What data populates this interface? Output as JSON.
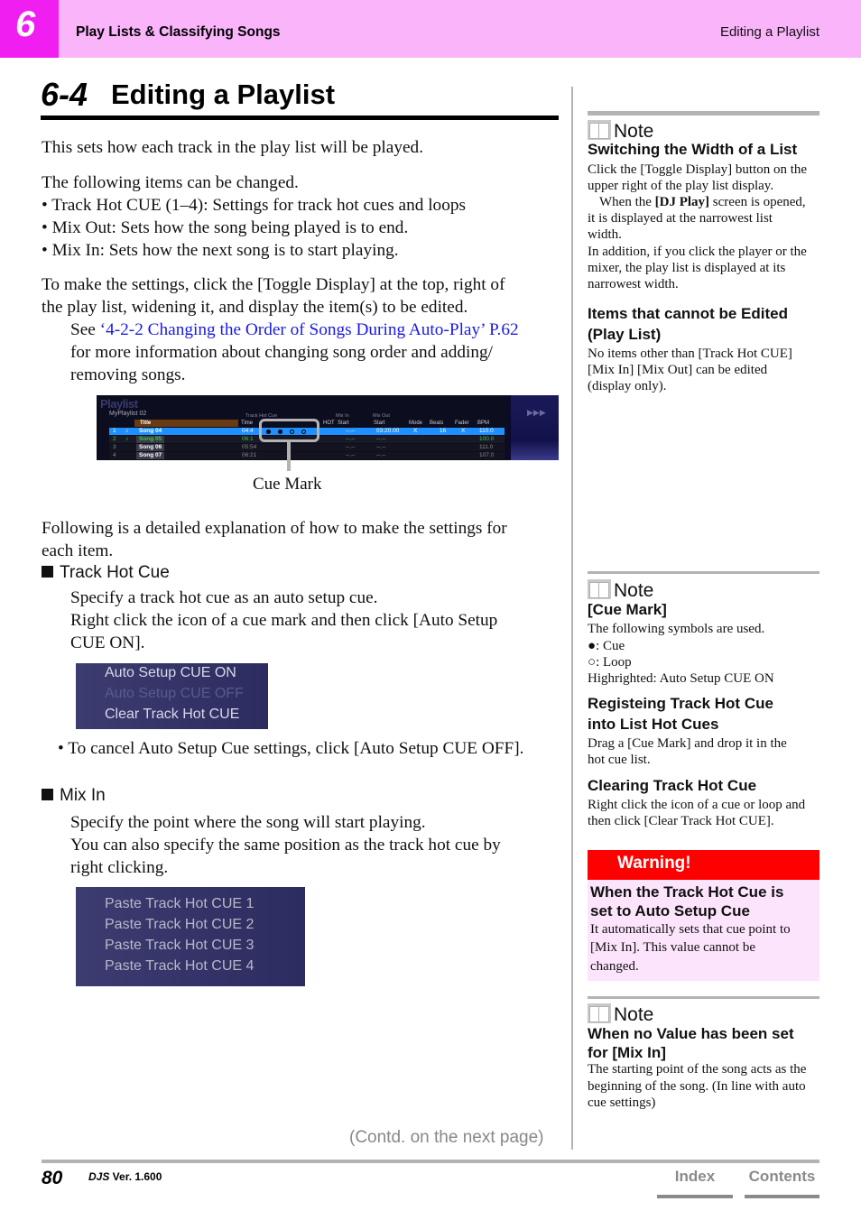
{
  "header": {
    "chapter_number": "6",
    "chapter_title": "Play Lists & Classifying Songs",
    "section_right": "Editing a Playlist"
  },
  "page_title": {
    "number": "6-4",
    "text": "Editing a Playlist"
  },
  "main": {
    "intro": "This sets how each track in the play list will be played.",
    "items_intro": "The following items can be changed.",
    "items": [
      "• Track Hot CUE (1–4): Settings for track hot cues and loops",
      "• Mix Out: Sets how the song being played is to end.",
      "• Mix In: Sets how the next song is to start playing."
    ],
    "settings_line1": "To make the settings, click the [Toggle Display] at the top, right of",
    "settings_line2": "the play list, widening it, and display the item(s) to be edited.",
    "see_prefix": "See ",
    "see_link": "‘4-2-2 Changing the Order of Songs During Auto-Play’ P.62",
    "see_line2": "for more information about changing song order and adding/",
    "see_line3": "removing songs.",
    "cue_mark_label": "Cue Mark",
    "detail_line1": "Following is a detailed explanation of how to make the settings for",
    "detail_line2": "each item.",
    "track_hot_cue": {
      "heading": "Track Hot Cue",
      "line1": "Specify a track hot cue as an auto setup cue.",
      "line2": "Right click the icon of a cue mark and then click [Auto Setup",
      "line3": "CUE ON].",
      "menu": [
        {
          "label": "Auto Setup CUE ON",
          "enabled": true
        },
        {
          "label": "Auto Setup CUE OFF",
          "enabled": false
        },
        {
          "label": "Clear Track Hot CUE",
          "enabled": true
        }
      ],
      "cancel_note": "•  To cancel Auto Setup Cue settings, click [Auto Setup CUE OFF]."
    },
    "mix_in": {
      "heading": "Mix In",
      "line1": "Specify the point where the song will start playing.",
      "line2": "You can also specify the same position as the track hot cue by",
      "line3": "right clicking.",
      "menu": [
        {
          "label": "Paste Track Hot CUE 1"
        },
        {
          "label": "Paste Track Hot CUE 2"
        },
        {
          "label": "Paste Track Hot CUE 3"
        },
        {
          "label": "Paste Track Hot CUE 4"
        }
      ]
    }
  },
  "playlist_screenshot": {
    "logo": "Playlist",
    "playlist_name": "MyPlaylist 02",
    "group_headers": {
      "track_hot_cue": "Track  Hot  Cue",
      "mix_in": "Mix  In",
      "mix_out": "Mix  Out"
    },
    "columns": [
      "Title",
      "Time",
      "1",
      "2",
      "3",
      "4",
      "HOT",
      "Start",
      "Start",
      "Mode",
      "Beats",
      "Fader",
      "BPM"
    ],
    "rows": [
      {
        "num": "1",
        "title": "Song 04",
        "time": "04:4",
        "cues": [
          "cue",
          "cue",
          "loop",
          "loop"
        ],
        "mix_in_start": "--.--",
        "mix_out_start": "03:20.00",
        "mode": "X",
        "beats": "16",
        "fader": "X",
        "bpm": "110.0",
        "state": "selected"
      },
      {
        "num": "2",
        "title": "Song 05",
        "time": "06:1",
        "cues": [],
        "mix_in_start": "--.--",
        "mix_out_start": "--.--",
        "mode": "",
        "beats": "",
        "fader": "",
        "bpm": "100.0",
        "state": "playing"
      },
      {
        "num": "3",
        "title": "Song 06",
        "time": "05:54",
        "cues": [],
        "mix_in_start": "--.--",
        "mix_out_start": "--.--",
        "mode": "",
        "beats": "",
        "fader": "",
        "bpm": "111.0",
        "state": "normal"
      },
      {
        "num": "4",
        "title": "Song 07",
        "time": "06:21",
        "cues": [],
        "mix_in_start": "--.--",
        "mix_out_start": "--.--",
        "mode": "",
        "beats": "",
        "fader": "",
        "bpm": "107.0",
        "state": "normal"
      }
    ]
  },
  "sidebar": {
    "note_label": "Note",
    "note1": {
      "heading": "Switching the Width of a List",
      "body_line1": "Click the [Toggle Display] button on the",
      "body_line2": "upper right of the play list display.",
      "body_line3_pre": "When the ",
      "body_line3_bold": "[DJ Play]",
      "body_line3_post": " screen is opened,",
      "body_line4": "it is displayed at the narrowest list",
      "body_line5": "width.",
      "body_line6": "In addition, if you click the player or the",
      "body_line7": "mixer, the play list is displayed at its",
      "body_line8": "narrowest width.",
      "heading2_line1": "Items that cannot be Edited",
      "heading2_line2": "(Play List)",
      "body2_line1": "No items other than [Track Hot CUE]",
      "body2_line2": "[Mix In] [Mix Out] can be edited",
      "body2_line3": "(display only)."
    },
    "note2": {
      "heading": "[Cue Mark]",
      "body_line1": "The following symbols are used.",
      "cue_symbol": "●",
      "cue_text": ": Cue",
      "loop_symbol": "○",
      "loop_text": ": Loop",
      "highlight_text": "Highrighted: Auto Setup CUE ON",
      "heading2_line1": "Registeing Track Hot Cue",
      "heading2_line2": "into List Hot Cues",
      "body2_line1": "Drag a [Cue Mark] and drop it in the",
      "body2_line2": "hot cue list.",
      "heading3": "Clearing Track Hot Cue",
      "body3_line1": "Right click the icon of a cue or loop and",
      "body3_line2": "then click [Clear Track Hot CUE]."
    },
    "warning": {
      "title": "Warning!",
      "heading_line1": "When the Track Hot Cue is",
      "heading_line2": "set to Auto Setup Cue",
      "body_line1": "It automatically sets that cue point to",
      "body_line2": "[Mix In]. This value cannot be",
      "body_line3": "changed.",
      "bar_color": "#ff0000",
      "bg_color": "#fce4fc"
    },
    "note3": {
      "heading_line1": "When no Value has been set",
      "heading_line2": "for [Mix In]",
      "body_line1": "The starting point of the song acts as the",
      "body_line2": "beginning of the song. (In line with auto",
      "body_line3": "cue settings)"
    }
  },
  "footer": {
    "contd": "(Contd. on the next page)",
    "page_number": "80",
    "product": "DJS",
    "version": " Ver. 1.600",
    "index_label": "Index",
    "contents_label": "Contents"
  },
  "colors": {
    "header_bg": "#fab4fa",
    "chapter_box": "#f01ef0",
    "link": "#1a1ae6"
  }
}
